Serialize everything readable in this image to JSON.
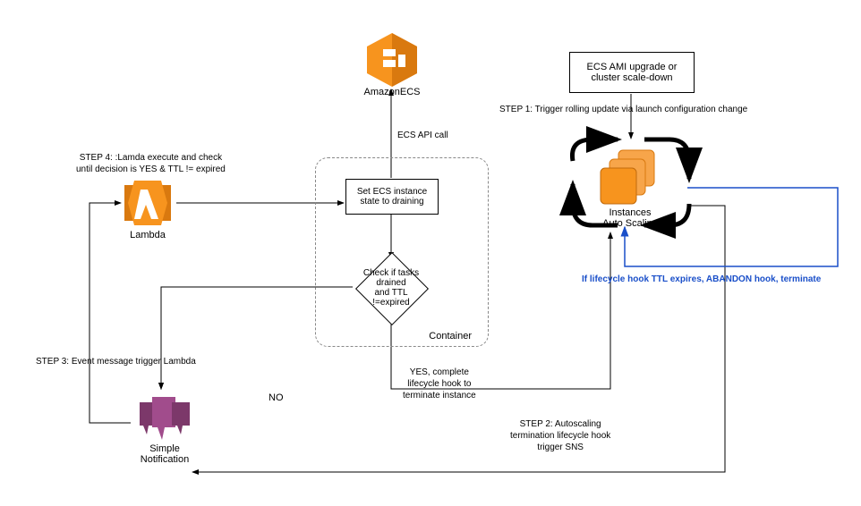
{
  "nodes": {
    "ecs_label": "AmazonECS",
    "lambda_label": "Lambda",
    "sns_label": "Simple\nNotification",
    "asg_label": "Instances\nAuto Scaling",
    "trigger_box": "ECS AMI upgrade or\ncluster scale-down",
    "set_state_box": "Set ECS instance\nstate to draining",
    "check_diamond": "Check if tasks drained\nand TTL !=expired",
    "container_group": "Container"
  },
  "edges": {
    "step1": "STEP 1: Trigger rolling update via launch configuration change",
    "step2": "STEP 2: Autoscaling\ntermination lifecycle hook\ntrigger SNS",
    "step3": "STEP 3: Event message trigger Lambda",
    "step4": "STEP 4: :Lamda execute and check\nuntil decision is YES & TTL != expired",
    "ecs_call": "ECS API call",
    "no": "NO",
    "yes": "YES, complete\nlifecycle hook to\nterminate instance",
    "abandon": "If lifecycle hook TTL expires, ABANDON hook, terminate"
  },
  "colors": {
    "orange": "#f7941e",
    "purple": "#a14c8c",
    "blue": "#1a4fc9"
  }
}
